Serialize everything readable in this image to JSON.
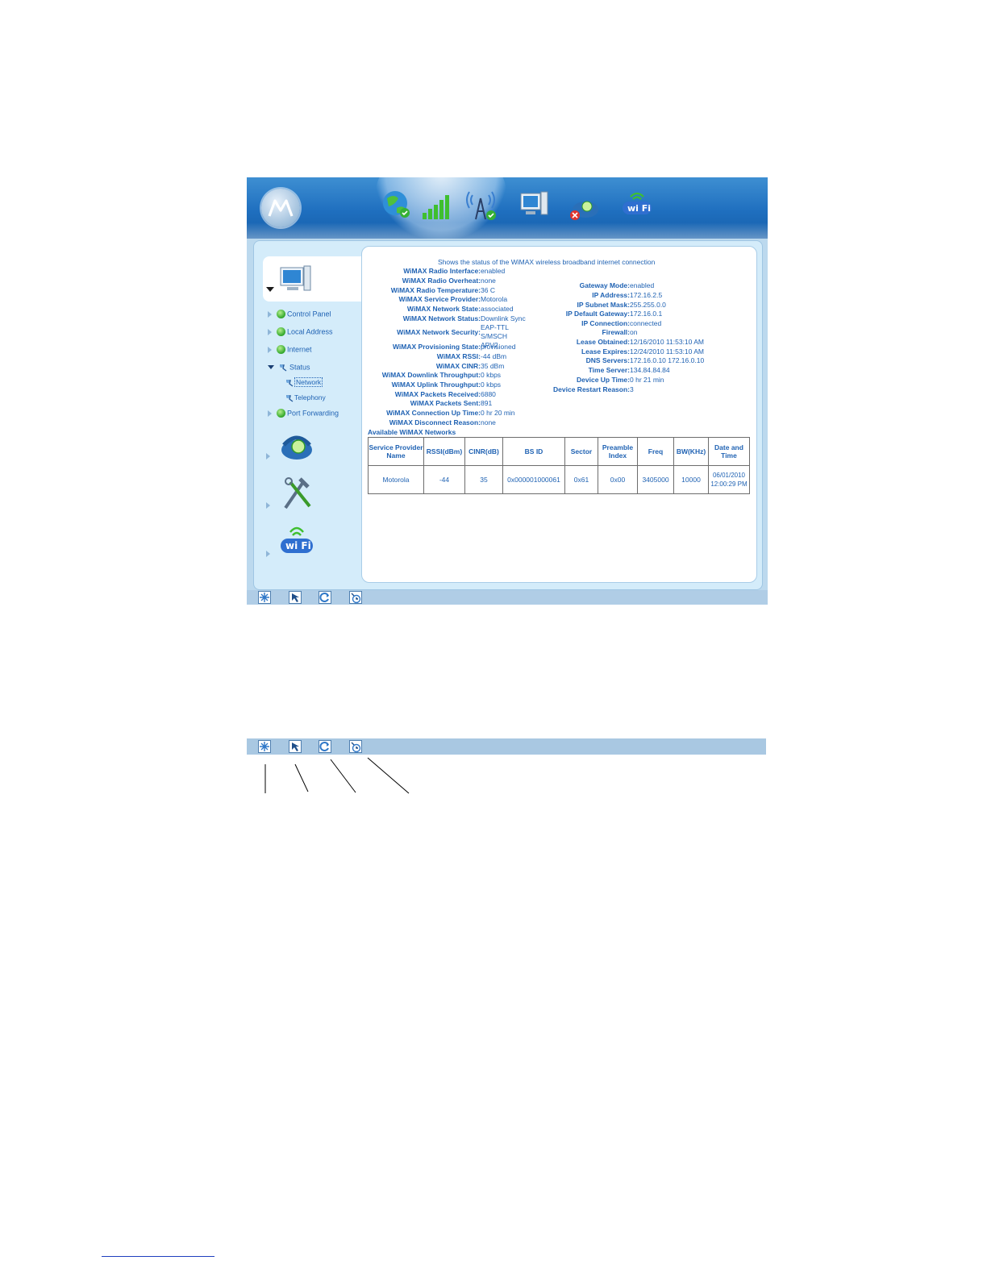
{
  "header": {
    "logo_icon": "motorola-logo-icon",
    "icons": [
      "internet-globe-icon",
      "signal-bars-icon",
      "wimax-tower-icon",
      "computer-icon",
      "telephony-disconnected-icon",
      "wifi-icon"
    ]
  },
  "nav": {
    "items": [
      {
        "label": "Control Panel"
      },
      {
        "label": "Local Address"
      },
      {
        "label": "Internet"
      },
      {
        "label": "Status"
      },
      {
        "label": "Port Forwarding"
      }
    ],
    "subitems": [
      {
        "label": "Network"
      },
      {
        "label": "Telephony"
      }
    ]
  },
  "status": {
    "description": "Shows the status of the WiMAX wireless broadband internet connection",
    "left": [
      {
        "key": "WiMAX Radio Interface:",
        "value": "enabled"
      },
      {
        "key": "WiMAX Radio Overheat:",
        "value": "none"
      },
      {
        "key": "WiMAX Radio Temperature:",
        "value": "36 C"
      },
      {
        "key": "WiMAX Service Provider:",
        "value": "Motorola"
      },
      {
        "key": "WiMAX Network State:",
        "value": "associated"
      },
      {
        "key": "WiMAX Network Status:",
        "value": "Downlink Sync"
      },
      {
        "key": "WiMAX Network Security:",
        "value": "EAP-TTLS/MSCHAPV2"
      },
      {
        "key": "WiMAX Provisioning State:",
        "value": "provisioned"
      },
      {
        "key": "WiMAX RSSI:",
        "value": "-44 dBm"
      },
      {
        "key": "WiMAX CINR:",
        "value": "35 dBm"
      },
      {
        "key": "WiMAX Downlink Throughput:",
        "value": "0 kbps"
      },
      {
        "key": "WiMAX Uplink Throughput:",
        "value": "0 kbps"
      },
      {
        "key": "WiMAX Packets Received:",
        "value": "6880"
      },
      {
        "key": "WiMAX Packets Sent:",
        "value": "891"
      },
      {
        "key": "WiMAX Connection Up Time:",
        "value": "0 hr 20 min"
      },
      {
        "key": "WiMAX Disconnect Reason:",
        "value": "none"
      }
    ],
    "right": [
      {
        "key": "Gateway Mode:",
        "value": "enabled"
      },
      {
        "key": "IP Address:",
        "value": "172.16.2.5"
      },
      {
        "key": "IP Subnet Mask:",
        "value": "255.255.0.0"
      },
      {
        "key": "IP Default Gateway:",
        "value": "172.16.0.1"
      },
      {
        "key": "IP Connection:",
        "value": "connected"
      },
      {
        "key": "Firewall:",
        "value": "on"
      },
      {
        "key": "Lease Obtained:",
        "value": "12/16/2010 11:53:10 AM"
      },
      {
        "key": "Lease Expires:",
        "value": "12/24/2010 11:53:10 AM"
      },
      {
        "key": "DNS Servers:",
        "value": "172.16.0.10 172.16.0.10"
      },
      {
        "key": "Time Server:",
        "value": "134.84.84.84"
      },
      {
        "key": "Device Up Time:",
        "value": "0 hr 21 min"
      },
      {
        "key": "Device Restart Reason:",
        "value": "3"
      }
    ]
  },
  "networks": {
    "title": "Available WiMAX Networks",
    "columns": [
      "Service Provider Name",
      "RSSI(dBm)",
      "CINR(dB)",
      "BS ID",
      "Sector",
      "Preamble Index",
      "Freq",
      "BW(KHz)",
      "Date and Time"
    ],
    "rows": [
      [
        "Motorola",
        "-44",
        "35",
        "0x000001000061",
        "0x61",
        "0x00",
        "3405000",
        "10000",
        "06/01/2010 12:00:29 PM"
      ]
    ]
  },
  "toolbar": {
    "icons": [
      "snowflake-reset-icon",
      "cursor-wizard-icon",
      "refresh-icon",
      "help-clock-icon"
    ]
  }
}
